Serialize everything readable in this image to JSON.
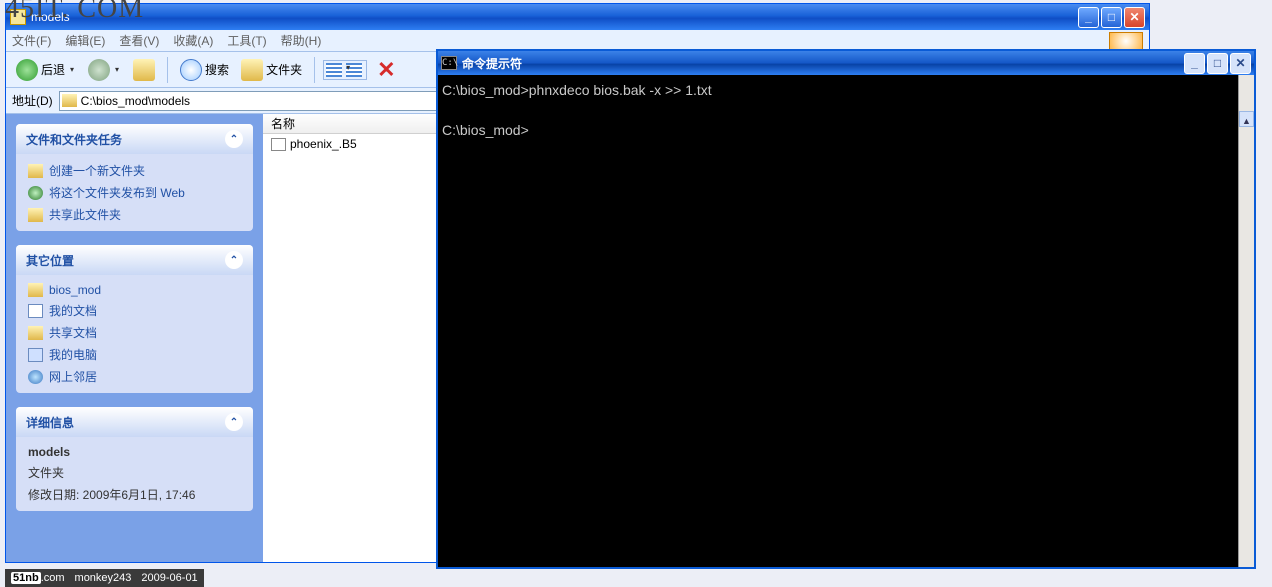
{
  "watermark": "45IT. COM",
  "explorer": {
    "title": "models",
    "menu": {
      "file": "文件(F)",
      "edit": "编辑(E)",
      "view": "查看(V)",
      "fav": "收藏(A)",
      "tools": "工具(T)",
      "help": "帮助(H)"
    },
    "toolbar": {
      "back": "后退",
      "search": "搜索",
      "folders": "文件夹"
    },
    "address": {
      "label": "地址(D)",
      "value": "C:\\bios_mod\\models"
    },
    "side": {
      "tasks": {
        "head": "文件和文件夹任务",
        "items": [
          "创建一个新文件夹",
          "将这个文件夹发布到 Web",
          "共享此文件夹"
        ]
      },
      "other": {
        "head": "其它位置",
        "items": [
          "bios_mod",
          "我的文档",
          "共享文档",
          "我的电脑",
          "网上邻居"
        ]
      },
      "detail": {
        "head": "详细信息",
        "name": "models",
        "type": "文件夹",
        "mod": "修改日期: 2009年6月1日, 17:46"
      }
    },
    "filelist": {
      "col": "名称",
      "items": [
        "phoenix_.B5"
      ]
    }
  },
  "cmd": {
    "title": "命令提示符",
    "lines": [
      "C:\\bios_mod>phnxdeco bios.bak -x >> 1.txt",
      "",
      "C:\\bios_mod>"
    ]
  },
  "footer": {
    "site": "51nb.com",
    "user": "monkey243",
    "date": "2009-06-01"
  }
}
